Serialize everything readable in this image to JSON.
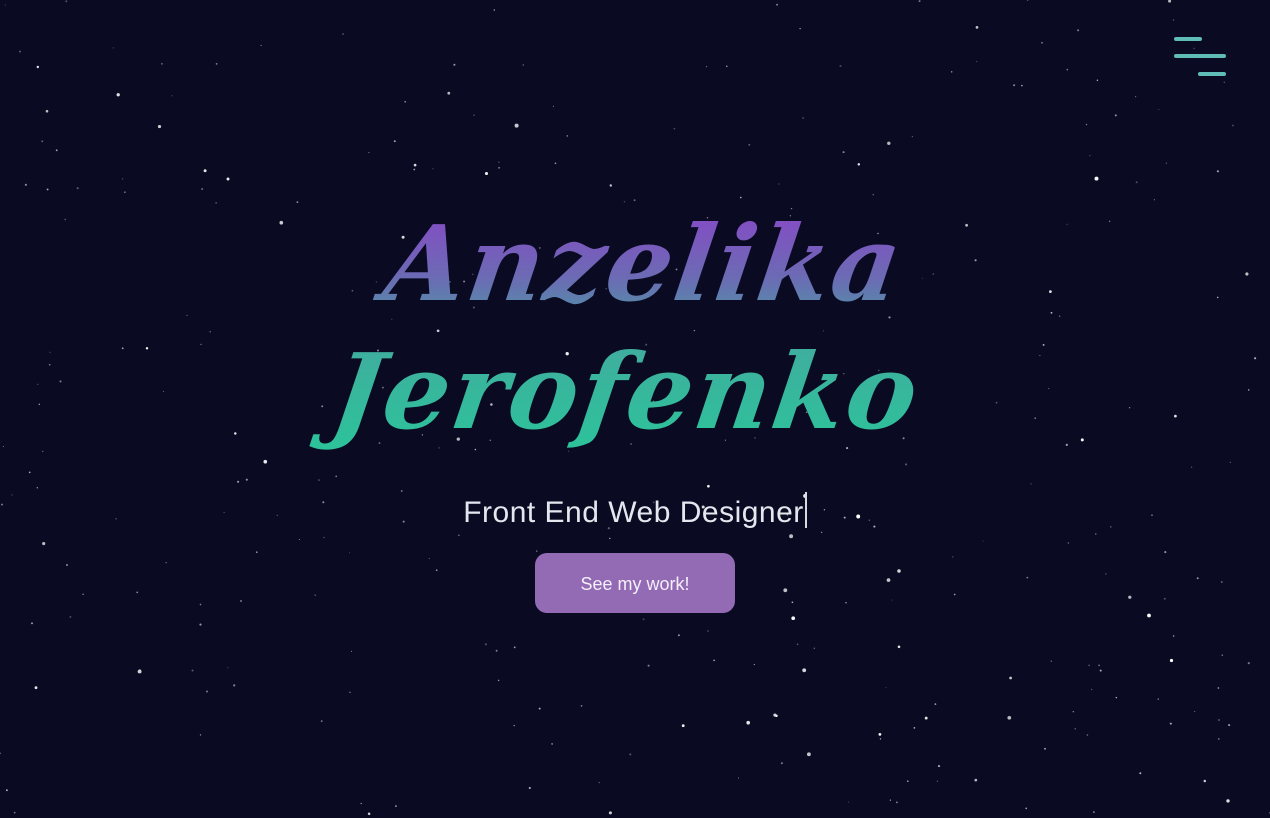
{
  "colors": {
    "background": "#0a0b23",
    "accent_teal": "#2bc49a",
    "accent_purple": "#8a45c8",
    "button_bg": "#936ab4",
    "menu_icon": "#5fbcb6"
  },
  "header": {
    "menu_icon": "hamburger-menu-icon"
  },
  "hero": {
    "first_name": "Anzelika",
    "last_name": "Jerofenko",
    "subtitle": "Front End Web Designer",
    "cta_label": "See my work!"
  }
}
